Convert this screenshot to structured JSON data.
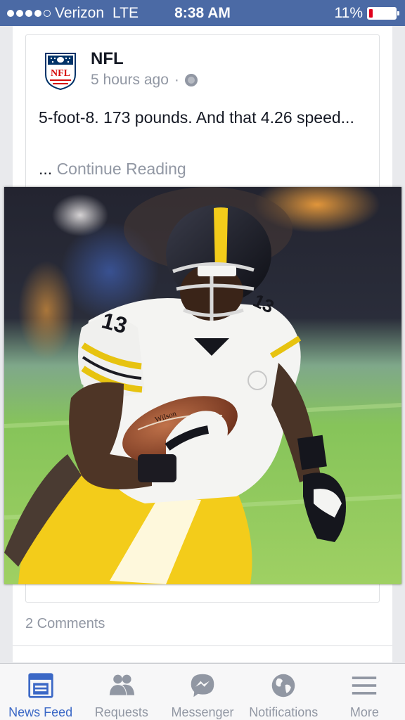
{
  "status_bar": {
    "carrier": "Verizon",
    "network": "LTE",
    "time": "8:38 AM",
    "battery": "11%"
  },
  "post": {
    "author": "NFL",
    "time_ago": "5 hours ago",
    "separator": "·",
    "text": "5-foot-8. 173 pounds. And that 4.26 speed...",
    "ellipsis": "...",
    "continue_label": "Continue Reading",
    "photo": {
      "jersey_number": "13",
      "ball_brand": "Wilson"
    },
    "comments": "2 Comments"
  },
  "tabs": [
    {
      "label": "News Feed",
      "icon": "news-feed-icon",
      "active": true
    },
    {
      "label": "Requests",
      "icon": "requests-icon",
      "active": false
    },
    {
      "label": "Messenger",
      "icon": "messenger-icon",
      "active": false
    },
    {
      "label": "Notifications",
      "icon": "globe-icon",
      "active": false
    },
    {
      "label": "More",
      "icon": "menu-icon",
      "active": false
    }
  ],
  "colors": {
    "status_bar": "#4b6aa5",
    "active_tab": "#3b68c6",
    "inactive_tab": "#9197a3",
    "steelers_gold": "#f3cc1a"
  }
}
